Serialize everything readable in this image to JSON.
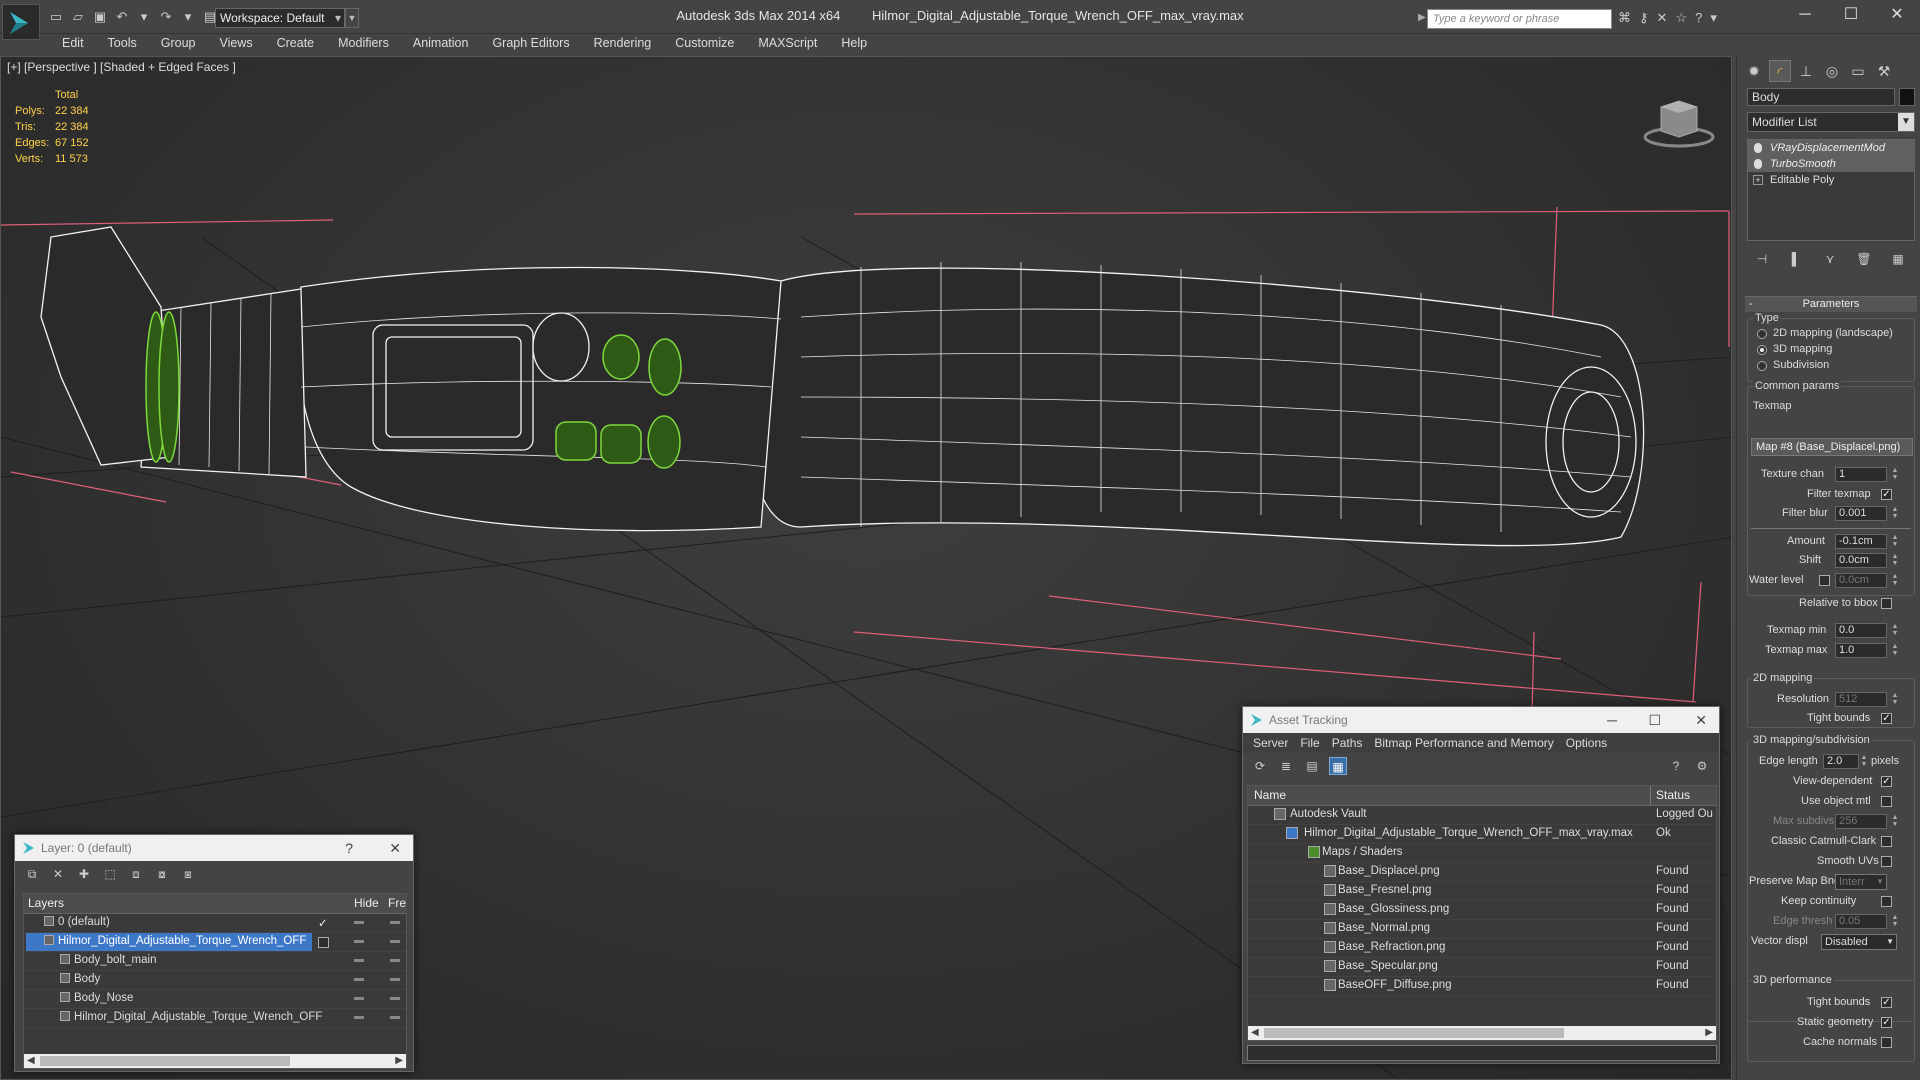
{
  "app": {
    "title_app": "Autodesk 3ds Max  2014 x64",
    "title_file": "Hilmor_Digital_Adjustable_Torque_Wrench_OFF_max_vray.max",
    "workspace": "Workspace: Default",
    "search_placeholder": "Type a keyword or phrase"
  },
  "menu": [
    "Edit",
    "Tools",
    "Group",
    "Views",
    "Create",
    "Modifiers",
    "Animation",
    "Graph Editors",
    "Rendering",
    "Customize",
    "MAXScript",
    "Help"
  ],
  "viewport": {
    "label": "[+] [Perspective ] [Shaded + Edged Faces ]",
    "stats_header": "Total",
    "stats": [
      {
        "k": "Polys:",
        "v": "22 384"
      },
      {
        "k": "Tris:",
        "v": "22 384"
      },
      {
        "k": "Edges:",
        "v": "67 152"
      },
      {
        "k": "Verts:",
        "v": "11 573"
      }
    ]
  },
  "command_panel": {
    "object_name": "Body",
    "modifier_list": "Modifier List",
    "stack": [
      "VRayDisplacementMod",
      "TurboSmooth",
      "Editable Poly"
    ],
    "params_title": "Parameters",
    "type_label": "Type",
    "type_options": [
      "2D mapping (landscape)",
      "3D mapping",
      "Subdivision"
    ],
    "common_params": "Common params",
    "texmap_label": "Texmap",
    "texmap_value": "Map #8 (Base_Displacel.png)",
    "texture_chan_label": "Texture chan",
    "texture_chan": "1",
    "filter_texmap": "Filter texmap",
    "filter_blur_label": "Filter blur",
    "filter_blur": "0.001",
    "amount_label": "Amount",
    "amount": "-0.1cm",
    "shift_label": "Shift",
    "shift": "0.0cm",
    "water_level_label": "Water level",
    "water_level": "0.0cm",
    "relative_bbox": "Relative to bbox",
    "texmap_min_label": "Texmap min",
    "texmap_min": "0.0",
    "texmap_max_label": "Texmap max",
    "texmap_max": "1.0",
    "mapping_2d": "2D mapping",
    "resolution_label": "Resolution",
    "resolution": "512",
    "tight_bounds": "Tight bounds",
    "mapping_3d": "3D mapping/subdivision",
    "edge_length_label": "Edge length",
    "edge_length": "2.0",
    "pixels": "pixels",
    "view_dependent": "View-dependent",
    "use_object_mtl": "Use object mtl",
    "max_subdivs_label": "Max subdivs",
    "max_subdivs": "256",
    "classic_catmull": "Classic Catmull-Clark",
    "smooth_uvs": "Smooth UVs",
    "preserve_map_label": "Preserve Map Bnd",
    "preserve_map": "Interr",
    "keep_continuity": "Keep continuity",
    "edge_thresh_label": "Edge thresh",
    "edge_thresh": "0.05",
    "vector_disp_label": "Vector displ",
    "vector_disp": "Disabled",
    "performance": "3D performance",
    "tight_bounds_2": "Tight bounds",
    "static_geometry": "Static geometry",
    "cache_normals": "Cache normals"
  },
  "asset_tracking": {
    "title": "Asset Tracking",
    "menu": [
      "Server",
      "File",
      "Paths",
      "Bitmap Performance and Memory",
      "Options"
    ],
    "col_name": "Name",
    "col_status": "Status",
    "rows": [
      {
        "name": "Autodesk Vault",
        "status": "Logged Ou"
      },
      {
        "name": "Hilmor_Digital_Adjustable_Torque_Wrench_OFF_max_vray.max",
        "status": "Ok"
      },
      {
        "name": "Maps / Shaders",
        "status": ""
      },
      {
        "name": "Base_Displacel.png",
        "status": "Found"
      },
      {
        "name": "Base_Fresnel.png",
        "status": "Found"
      },
      {
        "name": "Base_Glossiness.png",
        "status": "Found"
      },
      {
        "name": "Base_Normal.png",
        "status": "Found"
      },
      {
        "name": "Base_Refraction.png",
        "status": "Found"
      },
      {
        "name": "Base_Specular.png",
        "status": "Found"
      },
      {
        "name": "BaseOFF_Diffuse.png",
        "status": "Found"
      }
    ]
  },
  "layer_window": {
    "title": "Layer: 0 (default)",
    "help": "?",
    "col_layers": "Layers",
    "col_hide": "Hide",
    "col_freeze": "Freeze",
    "rows": [
      {
        "name": "0 (default)"
      },
      {
        "name": "Hilmor_Digital_Adjustable_Torque_Wrench_OFF"
      },
      {
        "name": "Body_bolt_main"
      },
      {
        "name": "Body"
      },
      {
        "name": "Body_Nose"
      },
      {
        "name": "Hilmor_Digital_Adjustable_Torque_Wrench_OFF"
      }
    ]
  },
  "colors": {
    "wire": "#ffffff",
    "selection_green": "#7ed83c",
    "bbox_pink": "#e0607a",
    "stats_yellow": "#ffd24a",
    "select_blue": "#3d78c8"
  }
}
